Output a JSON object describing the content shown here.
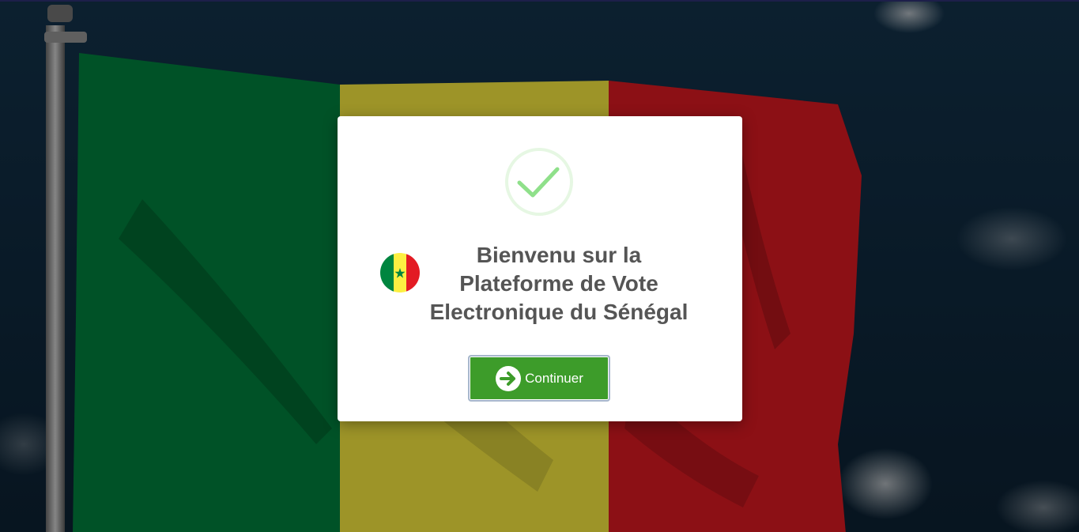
{
  "background": {
    "flag_colors": {
      "green": "#00853F",
      "yellow": "#FDEF42",
      "red": "#E31B23"
    },
    "sky_color": "#0f2436"
  },
  "modal": {
    "icon": "check-circle-icon",
    "icon_color": "#8fe08a",
    "title_lines": [
      "Bienvenu sur la",
      "Plateforme de Vote",
      "Electronique du Sénégal"
    ],
    "flag_icon": "senegal-flag-icon",
    "button": {
      "label": "Continuer",
      "icon": "arrow-right-circle-icon",
      "color": "#3d9c2a"
    }
  }
}
